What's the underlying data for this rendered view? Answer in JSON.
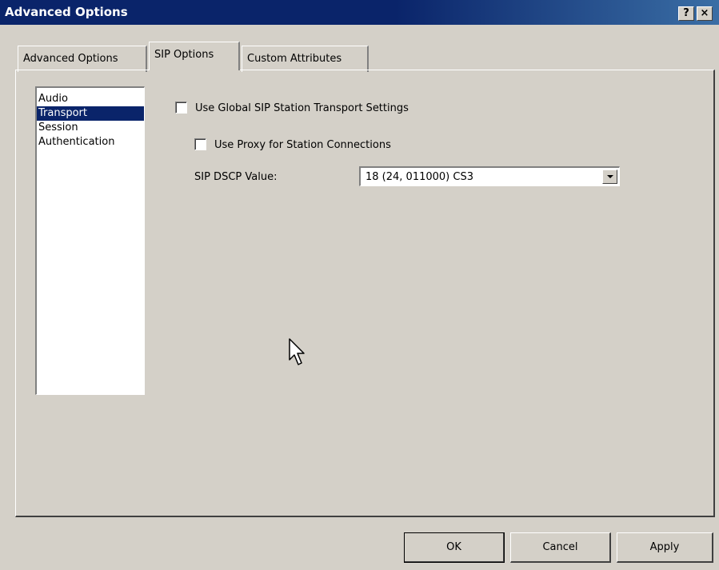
{
  "window": {
    "title": "Advanced Options",
    "help_label": "?",
    "close_label": "×"
  },
  "tabs": [
    {
      "label": "Advanced Options",
      "active": false
    },
    {
      "label": "SIP Options",
      "active": true
    },
    {
      "label": "Custom Attributes",
      "active": false
    }
  ],
  "categories": [
    {
      "label": "Audio",
      "selected": false
    },
    {
      "label": "Transport",
      "selected": true
    },
    {
      "label": "Session",
      "selected": false
    },
    {
      "label": "Authentication",
      "selected": false
    }
  ],
  "transport": {
    "use_global_label": "Use Global SIP Station Transport Settings",
    "use_global_checked": false,
    "use_proxy_label": "Use Proxy for Station Connections",
    "use_proxy_checked": false,
    "dscp_label": "SIP DSCP Value:",
    "dscp_value": "18 (24, 011000) CS3"
  },
  "buttons": {
    "ok": "OK",
    "cancel": "Cancel",
    "apply": "Apply"
  },
  "colors": {
    "titlebar": "#0a246a",
    "selection": "#0a246a",
    "face": "#d4d0c8"
  },
  "icons": [
    "checkbox-icon",
    "dropdown-arrow-icon",
    "mouse-cursor-icon"
  ]
}
